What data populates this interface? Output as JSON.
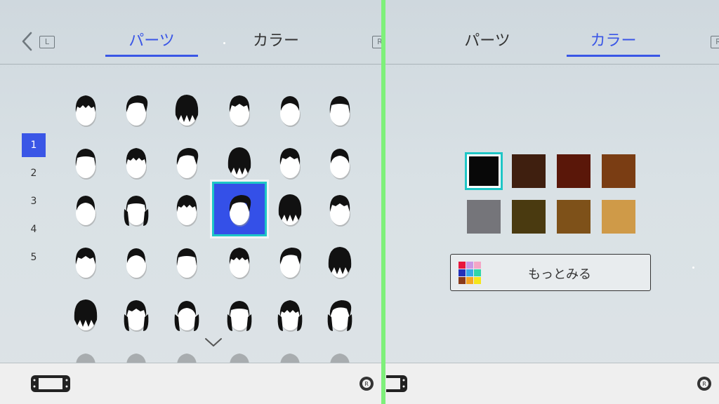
{
  "left": {
    "tabs": [
      {
        "label": "パーツ",
        "active": true
      },
      {
        "label": "カラー",
        "active": false
      }
    ],
    "back_hint": "L",
    "forward_hint": "R",
    "pages": [
      "1",
      "2",
      "3",
      "4",
      "5"
    ],
    "active_page": "1",
    "hair_grid": {
      "rows": 5,
      "cols": 6,
      "selected_index": 15
    }
  },
  "right": {
    "tabs": [
      {
        "label": "パーツ",
        "active": false
      },
      {
        "label": "カラー",
        "active": true
      }
    ],
    "forward_hint": "R",
    "colors": [
      "#080808",
      "#3f1f0f",
      "#5a1709",
      "#7a3d13",
      "#75757a",
      "#4a3a10",
      "#7e5119",
      "#cf9a48"
    ],
    "selected_color_index": 0,
    "more_button_label": "もっとみる",
    "more_palette": [
      "#e8173d",
      "#c998e6",
      "#f4a6c6",
      "#2230b8",
      "#36a8e8",
      "#2fd6a8",
      "#8a3a1a",
      "#f5a623",
      "#f5e61a"
    ]
  },
  "colors": {
    "accent": "#3a56e6",
    "selection_outline": "#1ec6c6",
    "divider": "#7ef07a"
  }
}
